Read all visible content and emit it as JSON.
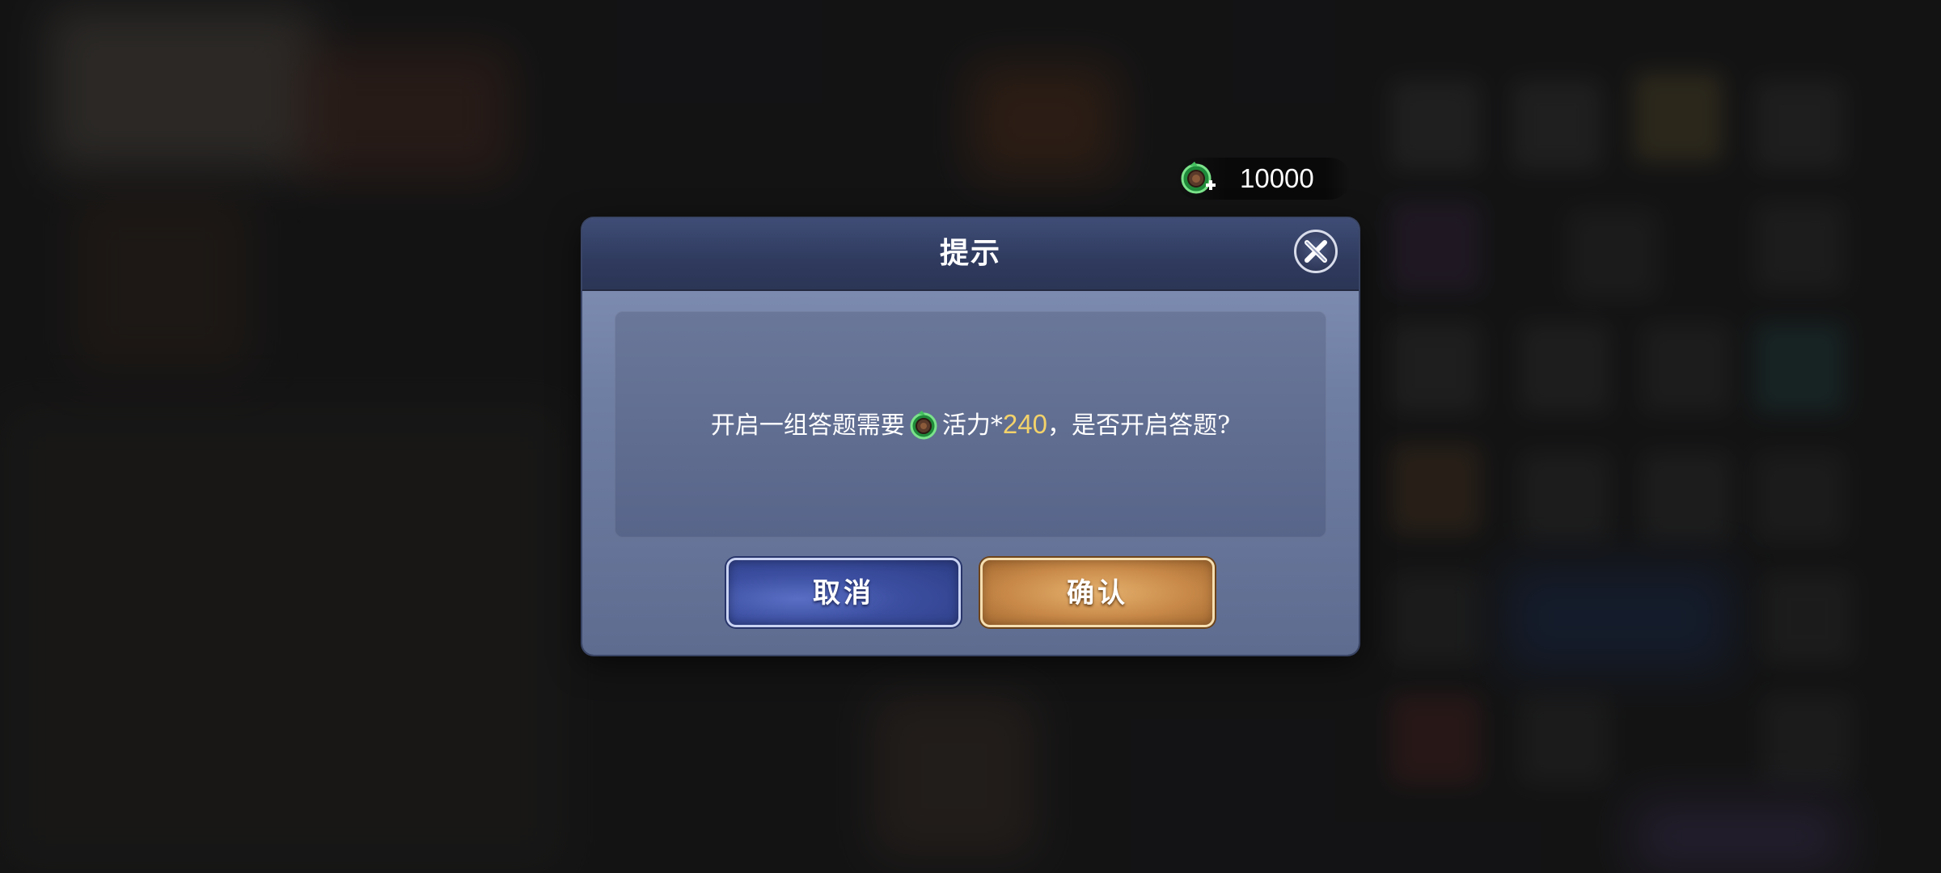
{
  "hud": {
    "currency_icon": "vitality-ring-plus-icon",
    "currency_value": "10000"
  },
  "dialog": {
    "title": "提示",
    "close_icon": "close-icon",
    "message_before": "开启一组答题需要",
    "message_icon": "vitality-ring-icon",
    "message_resource": "活力*",
    "message_amount": "240",
    "message_after": "，是否开启答题?",
    "cancel_label": "取消",
    "confirm_label": "确认"
  },
  "colors": {
    "highlight": "#f3d26a",
    "cancel_button": "#3b4ea0",
    "confirm_button": "#c98a49",
    "header": "#2f3a5e",
    "panel": "#6f7ea3"
  }
}
